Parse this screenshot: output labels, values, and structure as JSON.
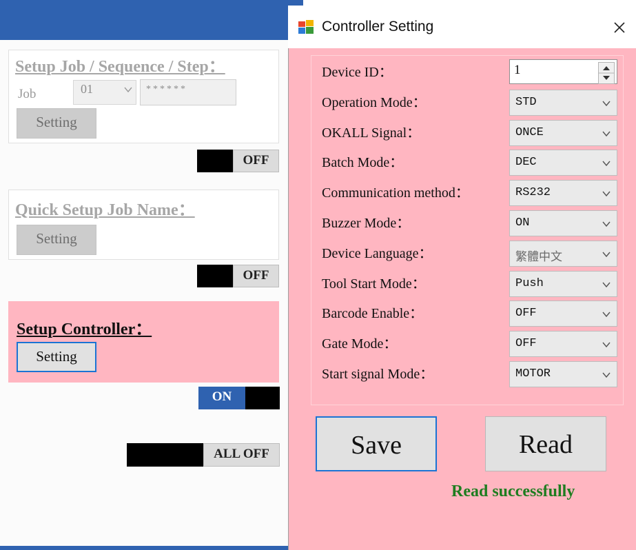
{
  "left_panel": {
    "job_group": {
      "title": "Setup Job / Sequence / Step：",
      "job_label": "Job",
      "job_value": "01",
      "password_mask": "******",
      "setting_label": "Setting",
      "toggle_label": "OFF"
    },
    "quick_group": {
      "title": "Quick Setup Job Name：",
      "setting_label": "Setting",
      "toggle_label": "OFF"
    },
    "controller_group": {
      "title": "Setup Controller：",
      "setting_label": "Setting",
      "toggle_label": "ON"
    },
    "all_off_label": "ALL OFF"
  },
  "dialog": {
    "title": "Controller Setting",
    "icon": "app-window-icon",
    "fields": [
      {
        "label": "Device ID：",
        "value": "1",
        "kind": "spinner"
      },
      {
        "label": "Operation Mode：",
        "value": "STD",
        "kind": "select"
      },
      {
        "label": "OKALL Signal：",
        "value": "ONCE",
        "kind": "select"
      },
      {
        "label": "Batch Mode：",
        "value": "DEC",
        "kind": "select"
      },
      {
        "label": "Communication method：",
        "value": "RS232",
        "kind": "select"
      },
      {
        "label": "Buzzer Mode：",
        "value": "ON",
        "kind": "select"
      },
      {
        "label": "Device Language：",
        "value": "繁體中文",
        "kind": "select"
      },
      {
        "label": "Tool Start Mode：",
        "value": "Push",
        "kind": "select"
      },
      {
        "label": "Barcode Enable：",
        "value": "OFF",
        "kind": "select"
      },
      {
        "label": "Gate Mode：",
        "value": "OFF",
        "kind": "select"
      },
      {
        "label": "Start signal Mode：",
        "value": "MOTOR",
        "kind": "select"
      }
    ],
    "save_label": "Save",
    "read_label": "Read",
    "status_text": "Read successfully"
  },
  "colors": {
    "dialog_bg": "#ffb6c1",
    "accent_blue": "#2f62b0",
    "focus_blue": "#1a73d4",
    "status_green": "#1e7d20"
  }
}
